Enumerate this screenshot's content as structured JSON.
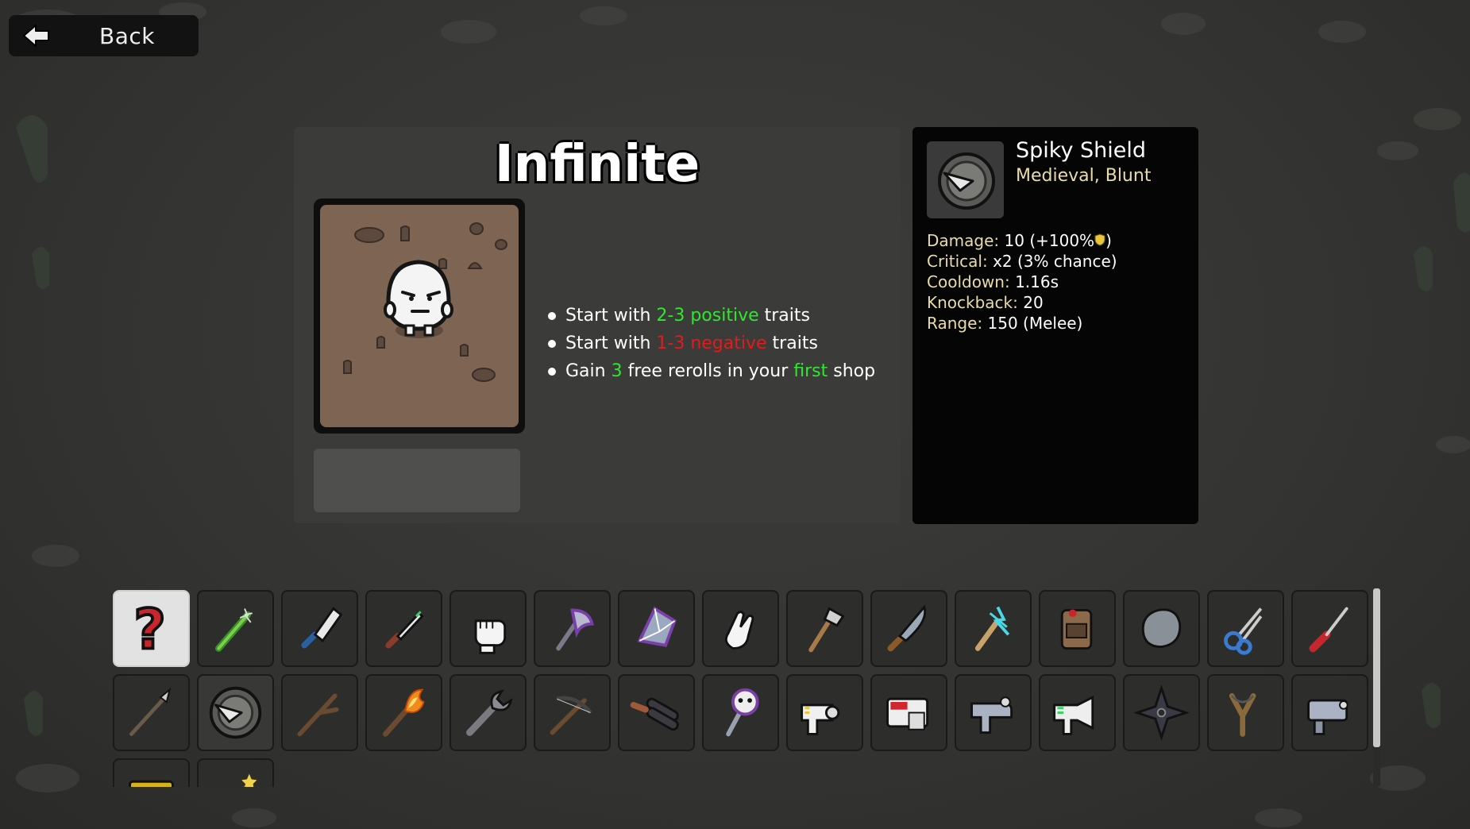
{
  "back": {
    "label": "Back",
    "icon": "back-arrow-icon"
  },
  "character": {
    "name": "Infinite",
    "traits": [
      {
        "parts": [
          {
            "text": "Start with ",
            "style": "normal"
          },
          {
            "text": "2-3 positive",
            "style": "green"
          },
          {
            "text": " traits",
            "style": "normal"
          }
        ]
      },
      {
        "parts": [
          {
            "text": "Start with ",
            "style": "normal"
          },
          {
            "text": "1-3 negative",
            "style": "red"
          },
          {
            "text": " traits",
            "style": "normal"
          }
        ]
      },
      {
        "parts": [
          {
            "text": "Gain ",
            "style": "normal"
          },
          {
            "text": "3",
            "style": "green"
          },
          {
            "text": " free rerolls in your ",
            "style": "normal"
          },
          {
            "text": "first",
            "style": "green"
          },
          {
            "text": " shop",
            "style": "normal"
          }
        ]
      }
    ]
  },
  "item": {
    "name": "Spiky Shield",
    "tags": "Medieval, Blunt",
    "icon": "spiky-shield-icon",
    "stats": [
      {
        "key": "Damage",
        "value": "10 (+100%",
        "suffix": ")",
        "has_icon": true,
        "icon": "armor-shield-icon"
      },
      {
        "key": "Critical",
        "value": "x2 (3% chance)"
      },
      {
        "key": "Cooldown",
        "value": "1.16s"
      },
      {
        "key": "Knockback",
        "value": "20"
      },
      {
        "key": "Range",
        "value": "150 (Melee)"
      }
    ]
  },
  "weapons": [
    {
      "icon": "random-question-icon",
      "state": "selected"
    },
    {
      "icon": "spiked-club-icon"
    },
    {
      "icon": "cleaver-icon"
    },
    {
      "icon": "knife-icon"
    },
    {
      "icon": "fist-icon"
    },
    {
      "icon": "cursed-axe-icon"
    },
    {
      "icon": "crystal-shard-icon"
    },
    {
      "icon": "hand-icon"
    },
    {
      "icon": "hatchet-icon"
    },
    {
      "icon": "combat-knife-icon"
    },
    {
      "icon": "lightning-staff-icon"
    },
    {
      "icon": "backpack-icon"
    },
    {
      "icon": "rock-icon"
    },
    {
      "icon": "scissors-icon"
    },
    {
      "icon": "screwdriver-icon"
    },
    {
      "icon": "spear-icon"
    },
    {
      "icon": "spiky-shield-icon",
      "state": "active"
    },
    {
      "icon": "stick-icon"
    },
    {
      "icon": "torch-icon"
    },
    {
      "icon": "wrench-icon"
    },
    {
      "icon": "crossbow-icon"
    },
    {
      "icon": "double-barrel-icon"
    },
    {
      "icon": "skull-staff-icon"
    },
    {
      "icon": "laser-gun-icon"
    },
    {
      "icon": "red-shredder-icon"
    },
    {
      "icon": "plasma-gun-icon"
    },
    {
      "icon": "megaphone-gun-icon"
    },
    {
      "icon": "shuriken-icon"
    },
    {
      "icon": "slingshot-icon"
    },
    {
      "icon": "minigun-icon"
    },
    {
      "icon": "gold-block-icon"
    },
    {
      "icon": "magic-wand-icon"
    }
  ],
  "scroll_fraction": 0.8
}
